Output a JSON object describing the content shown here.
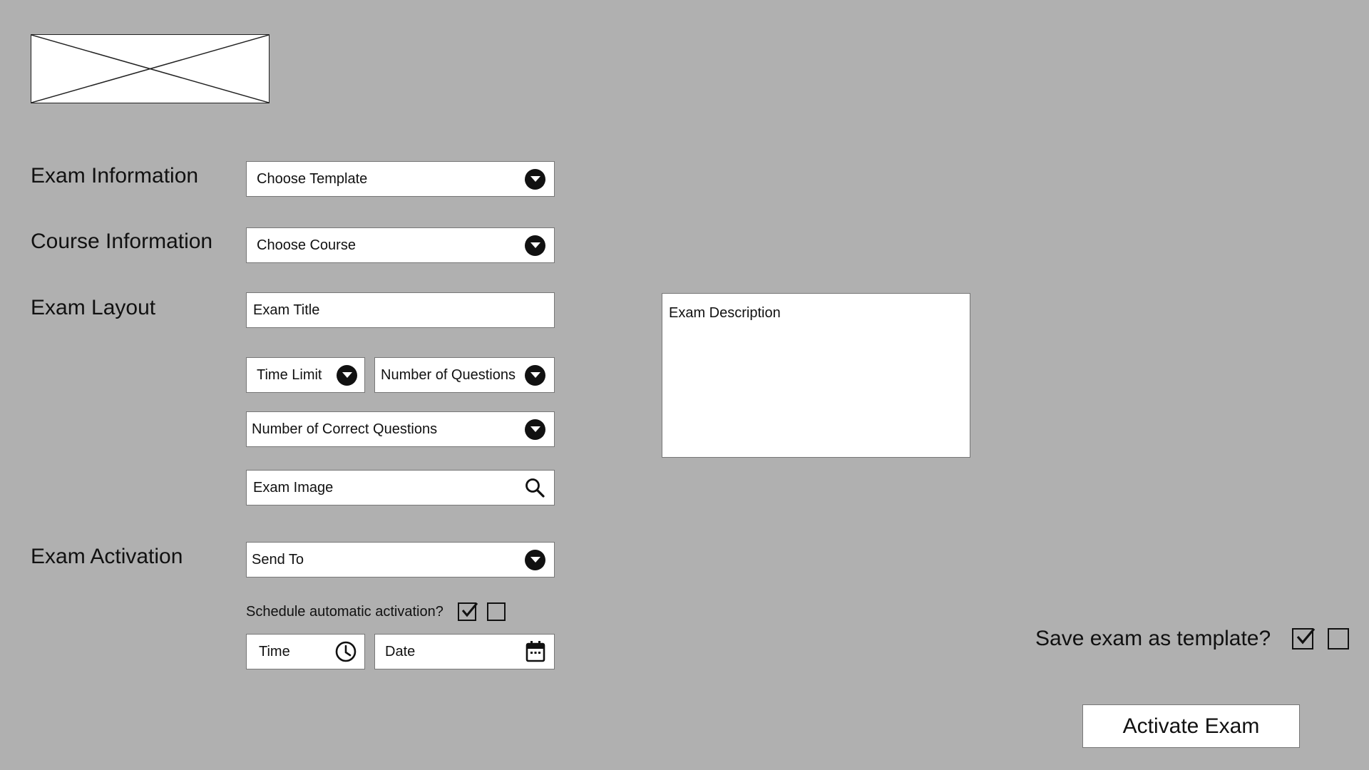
{
  "sections": {
    "exam_information": "Exam Information",
    "course_information": "Course Information",
    "exam_layout": "Exam Layout",
    "exam_activation": "Exam Activation"
  },
  "fields": {
    "choose_template": "Choose Template",
    "choose_course": "Choose Course",
    "exam_title": "Exam Title",
    "time_limit": "Time Limit",
    "number_of_questions": "Number of Questions",
    "number_of_correct_questions": "Number of Correct Questions",
    "exam_image": "Exam Image",
    "send_to": "Send To",
    "time": "Time",
    "date": "Date",
    "exam_description": "Exam Description"
  },
  "schedule": {
    "question": "Schedule automatic activation?"
  },
  "template_option": {
    "question": "Save exam as template?"
  },
  "actions": {
    "activate_exam": "Activate Exam"
  },
  "icons": {
    "logo": "image-placeholder-icon",
    "dropdown": "chevron-down-icon",
    "search": "search-icon",
    "clock": "clock-icon",
    "calendar": "calendar-icon",
    "check": "checkbox-checked-icon"
  },
  "colors": {
    "background": "#b0b0b0",
    "field": "#ffffff",
    "icon": "#111111"
  }
}
